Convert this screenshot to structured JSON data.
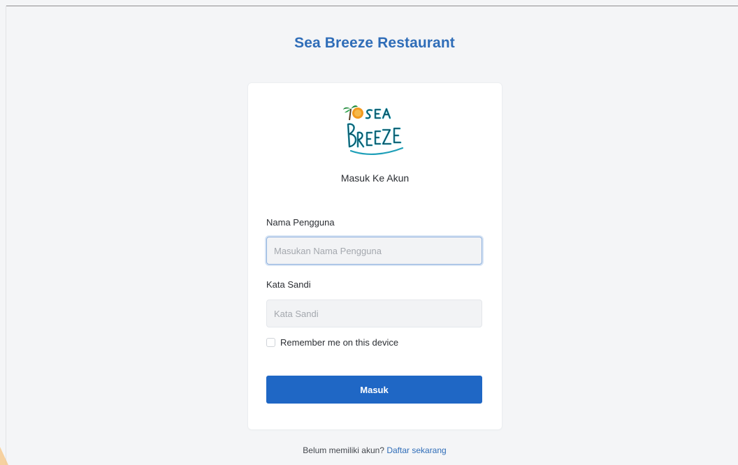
{
  "app": {
    "title": "Sea Breeze Restaurant"
  },
  "logo": {
    "name": "sea-breeze-logo",
    "lettering": "SEA BREEZE"
  },
  "login": {
    "heading": "Masuk Ke Akun",
    "username_label": "Nama Pengguna",
    "username_placeholder": "Masukan Nama Pengguna",
    "username_value": "",
    "password_label": "Kata Sandi",
    "password_placeholder": "Kata Sandi",
    "password_value": "",
    "remember_label": "Remember me on this device",
    "remember_checked": false,
    "submit_label": "Masuk"
  },
  "footer": {
    "prompt": "Belum memiliki akun?",
    "register_link": "Daftar sekarang"
  },
  "colors": {
    "brand": "#2f6db8",
    "button": "#1f67c5",
    "background": "#f4f5f7",
    "card": "#ffffff"
  }
}
